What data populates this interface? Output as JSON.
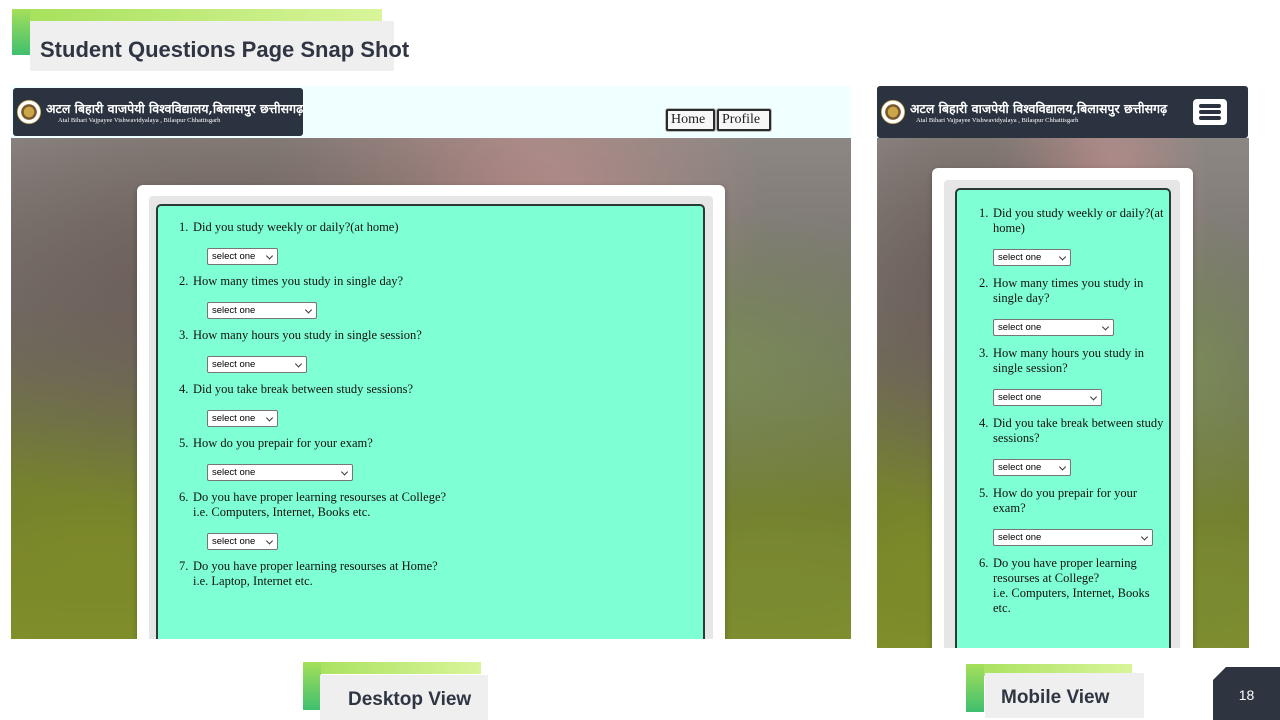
{
  "slide": {
    "title": "Student Questions Page Snap Shot",
    "desktop_label": "Desktop View",
    "mobile_label": "Mobile View",
    "page_number": "18"
  },
  "site": {
    "logo_hindi": "अटल बिहारी वाजपेयी विश्वविद्यालय,बिलासपुर छत्तीसगढ़",
    "logo_english": "Atal Bihari Vajpayee Vishwavidyalaya , Bilaspur Chhattisgarh",
    "nav": {
      "home": "Home",
      "profile": "Profile"
    }
  },
  "questions": [
    {
      "number": "1.",
      "text": "Did you study weekly or daily?(at home)",
      "select": "select one"
    },
    {
      "number": "2.",
      "text": "How many times you study in single day?",
      "select": "select one"
    },
    {
      "number": "3.",
      "text": "How many hours you study in single session?",
      "select": "select one"
    },
    {
      "number": "4.",
      "text": "Did you take break between study sessions?",
      "select": "select one"
    },
    {
      "number": "5.",
      "text": "How do you prepair for your exam?",
      "select": "select one"
    },
    {
      "number": "6.",
      "text": "Do you have proper learning resourses at College?",
      "subtext": "i.e. Computers, Internet, Books etc.",
      "select": "select one"
    },
    {
      "number": "7.",
      "text": "Do you have proper learning resourses at Home?",
      "subtext": "i.e. Laptop, Internet etc."
    }
  ],
  "colors": {
    "form_background": "#7fffd4",
    "header_background": "#f0ffff",
    "logo_box": "#2b3240",
    "accent_green": "#a5e05a",
    "page_number_box": "#2e3440"
  },
  "icons": {
    "menu": "hamburger-menu-icon",
    "emblem": "university-emblem-icon"
  }
}
